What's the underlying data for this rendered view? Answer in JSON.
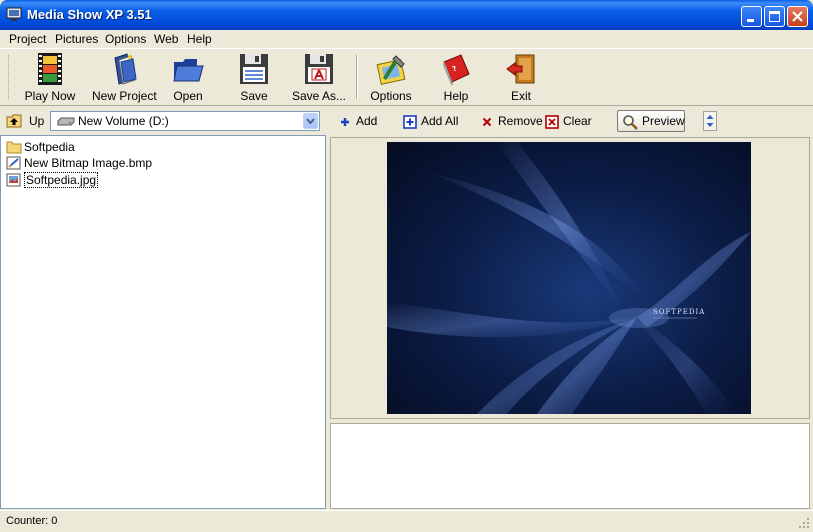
{
  "window": {
    "title": "Media Show XP 3.51"
  },
  "menu": [
    "Project",
    "Pictures",
    "Options",
    "Web",
    "Help"
  ],
  "toolbar": {
    "play_now": "Play Now",
    "new_project": "New Project",
    "open": "Open",
    "save": "Save",
    "save_as": "Save As...",
    "options": "Options",
    "help": "Help",
    "exit": "Exit"
  },
  "left": {
    "up_label": "Up",
    "drive": "New Volume (D:)",
    "files": [
      {
        "name": "Softpedia",
        "icon": "folder-icon"
      },
      {
        "name": "New Bitmap Image.bmp",
        "icon": "bitmap-file-icon"
      },
      {
        "name": "Softpedia.jpg",
        "icon": "jpeg-file-icon",
        "selected": true
      }
    ]
  },
  "right": {
    "add": "Add",
    "add_all": "Add All",
    "remove": "Remove",
    "clear": "Clear",
    "preview": "Preview"
  },
  "image": {
    "brand_text": "SOFTPEDIA"
  },
  "status": {
    "counter": "Counter: 0"
  },
  "colors": {
    "titlebar": "#0a5fe8",
    "chrome": "#ece9d8",
    "accent_add": "#1b3fbf",
    "accent_remove": "#b30000"
  }
}
